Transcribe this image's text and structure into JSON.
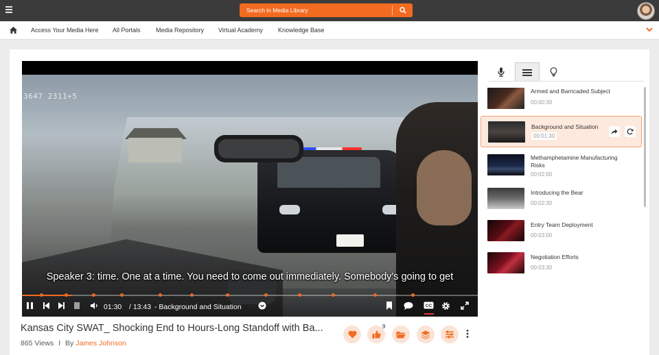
{
  "header": {
    "search_placeholder": "Search in Media Library",
    "brand_color": "#f26b21"
  },
  "nav": {
    "items": [
      "Access Your Media Here",
      "All Portals",
      "Media Repository",
      "Virtual Academy",
      "Knowledge Base"
    ]
  },
  "video": {
    "watermark": "3647 2311+5",
    "caption": "Speaker 3: time. One at a time. You need to come out immediately. Somebody's going to get",
    "current_time": "01:30",
    "duration": "/ 13:43",
    "current_chapter": "- Background and Situation",
    "progress": 0.11
  },
  "info": {
    "title": "Kansas City SWAT_ Shocking End to Hours-Long Standoff with Ba...",
    "views": "865 Views",
    "separator": "I",
    "by": "By",
    "author": "James Johnson",
    "like_count": "9"
  },
  "sidebar": {
    "tabs": [
      "microphone-icon",
      "list-icon",
      "lightbulb-icon"
    ],
    "active_tab": 1,
    "chapters": [
      {
        "title": "Armed and Barricaded Subject",
        "time": "00:00:30"
      },
      {
        "title": "Background and Situation",
        "time": "00:01:30",
        "active": true
      },
      {
        "title": "Methamphetamine Manufacturing Risks",
        "time": "00:02:00"
      },
      {
        "title": "Introducing the Bear",
        "time": "00:02:30"
      },
      {
        "title": "Entry Team Deployment",
        "time": "00:03:00"
      },
      {
        "title": "Negotiation Efforts",
        "time": "00:03:30"
      }
    ]
  }
}
